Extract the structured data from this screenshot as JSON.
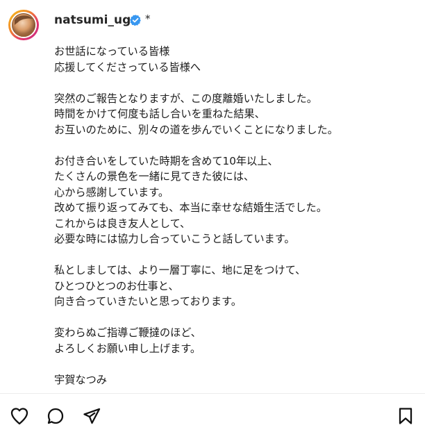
{
  "post": {
    "username": "natsumi_uga",
    "separator": "*",
    "lines": [
      "お世話になっている皆様",
      "応援してくださっている皆様へ",
      "",
      "突然のご報告となりますが、この度離婚いたしました。",
      "時間をかけて何度も話し合いを重ねた結果、",
      "お互いのために、別々の道を歩んでいくことになりました。",
      "",
      "お付き合いをしていた時期を含めて10年以上、",
      "たくさんの景色を一緒に見てきた彼には、",
      "心から感謝しています。",
      "改めて振り返ってみても、本当に幸せな結婚生活でした。",
      "これからは良き友人として、",
      "必要な時には協力し合っていこうと話しています。",
      "",
      "私としましては、より一層丁寧に、地に足をつけて、",
      "ひとつひとつのお仕事と、",
      "向き合っていきたいと思っております。",
      "",
      "変わらぬご指導ご鞭撻のほど、",
      "よろしくお願い申し上げます。",
      "",
      "宇賀なつみ"
    ]
  },
  "icons": {
    "verified": "verified-badge-icon",
    "like": "heart-icon",
    "comment": "comment-bubble-icon",
    "share": "paper-plane-icon",
    "save": "bookmark-icon"
  },
  "colors": {
    "verified_blue": "#3897f0",
    "text": "#1c1c1c",
    "username": "#262626"
  }
}
